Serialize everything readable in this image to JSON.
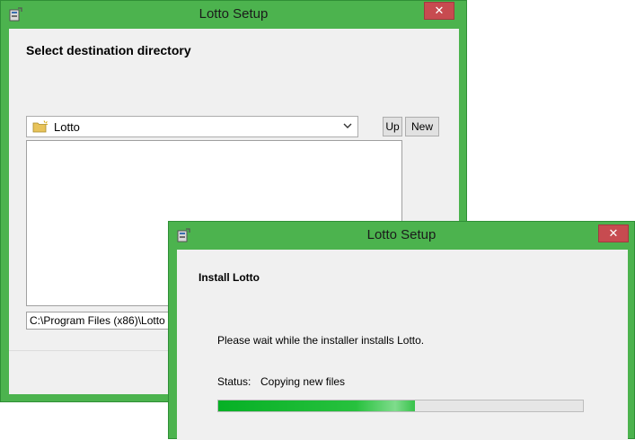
{
  "back_window": {
    "title": "Lotto Setup",
    "close_glyph": "✕",
    "heading": "Select destination directory",
    "folder_combo": {
      "value": "Lotto",
      "icon": "folder-icon"
    },
    "up_label": "Up",
    "new_label": "New",
    "path_value": "C:\\Program Files (x86)\\Lotto"
  },
  "front_window": {
    "title": "Lotto Setup",
    "close_glyph": "✕",
    "heading": "Install Lotto",
    "message": "Please wait while the installer installs Lotto.",
    "status_label": "Status:",
    "status_value": "Copying new files",
    "progress_fraction": 0.54
  },
  "colors": {
    "frame": "#4cb34e",
    "close_button": "#c74b50",
    "client": "#f0f0f0",
    "progress": "#06b025"
  }
}
